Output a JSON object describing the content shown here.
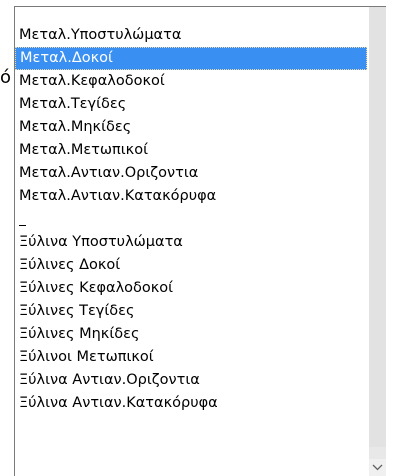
{
  "behind_fragment": "ό",
  "listbox": {
    "items": [
      {
        "label": "Μεταλ.Υποστυλώματα",
        "selected": false
      },
      {
        "label": "Μεταλ.Δοκοί",
        "selected": true
      },
      {
        "label": "Μεταλ.Κεφαλοδοκοί",
        "selected": false
      },
      {
        "label": "Μεταλ.Τεγίδες",
        "selected": false
      },
      {
        "label": "Μεταλ.Μηκίδες",
        "selected": false
      },
      {
        "label": "Μεταλ.Μετωπικοί",
        "selected": false
      },
      {
        "label": "Μεταλ.Αντιαν.Οριζοντια",
        "selected": false
      },
      {
        "label": "Μεταλ.Αντιαν.Κατακόρυφα",
        "selected": false
      },
      {
        "label": "",
        "selected": false,
        "blank": true
      },
      {
        "label": "Ξύλινα Υποστυλώματα",
        "selected": false
      },
      {
        "label": "Ξύλινες Δοκοί",
        "selected": false
      },
      {
        "label": "Ξύλινες Κεφαλοδοκοί",
        "selected": false
      },
      {
        "label": "Ξύλινες Τεγίδες",
        "selected": false
      },
      {
        "label": "Ξύλινες Μηκίδες",
        "selected": false
      },
      {
        "label": "Ξύλινοι Μετωπικοί",
        "selected": false
      },
      {
        "label": "Ξύλινα Αντιαν.Οριζοντια",
        "selected": false
      },
      {
        "label": "Ξύλινα Αντιαν.Κατακόρυφα",
        "selected": false
      }
    ],
    "scroll_down_icon": "chevron-down-icon"
  },
  "colors": {
    "selection": "#3a8ff2",
    "selection_text": "#ffffff",
    "scrollbar_track": "#e8e8e8"
  }
}
